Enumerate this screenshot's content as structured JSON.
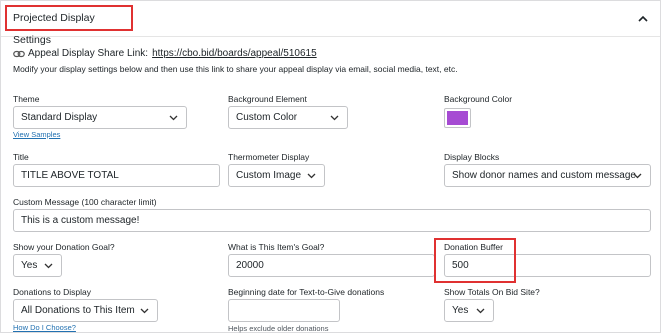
{
  "header": {
    "title": "Projected Display Settings"
  },
  "share": {
    "label": "Appeal Display Share Link:",
    "url": "https://cbo.bid/boards/appeal/510615",
    "description": "Modify your display settings below and then use this link to share your appeal display via email, social media, text, etc."
  },
  "theme": {
    "label": "Theme",
    "value": "Standard Display",
    "link": "View Samples"
  },
  "background_element": {
    "label": "Background Element",
    "value": "Custom Color"
  },
  "background_color": {
    "label": "Background Color",
    "color": "#a64bd3"
  },
  "title": {
    "label": "Title",
    "value": "TITLE ABOVE TOTAL"
  },
  "thermometer": {
    "label": "Thermometer Display",
    "value": "Custom Image"
  },
  "display_blocks": {
    "label": "Display Blocks",
    "value": "Show donor names and custom message"
  },
  "custom_message": {
    "label": "Custom Message (100 character limit)",
    "value": "This is a custom message!"
  },
  "show_goal": {
    "label": "Show your Donation Goal?",
    "value": "Yes"
  },
  "item_goal": {
    "label": "What is This Item's Goal?",
    "value": "20000"
  },
  "donation_buffer": {
    "label": "Donation Buffer",
    "value": "500"
  },
  "donations_to_display": {
    "label": "Donations to Display",
    "value": "All Donations to This Item",
    "link": "How Do I Choose?"
  },
  "begin_date": {
    "label": "Beginning date for Text-to-Give donations",
    "value": "",
    "help": "Helps exclude older donations"
  },
  "show_totals": {
    "label": "Show Totals On Bid Site?",
    "value": "Yes"
  }
}
